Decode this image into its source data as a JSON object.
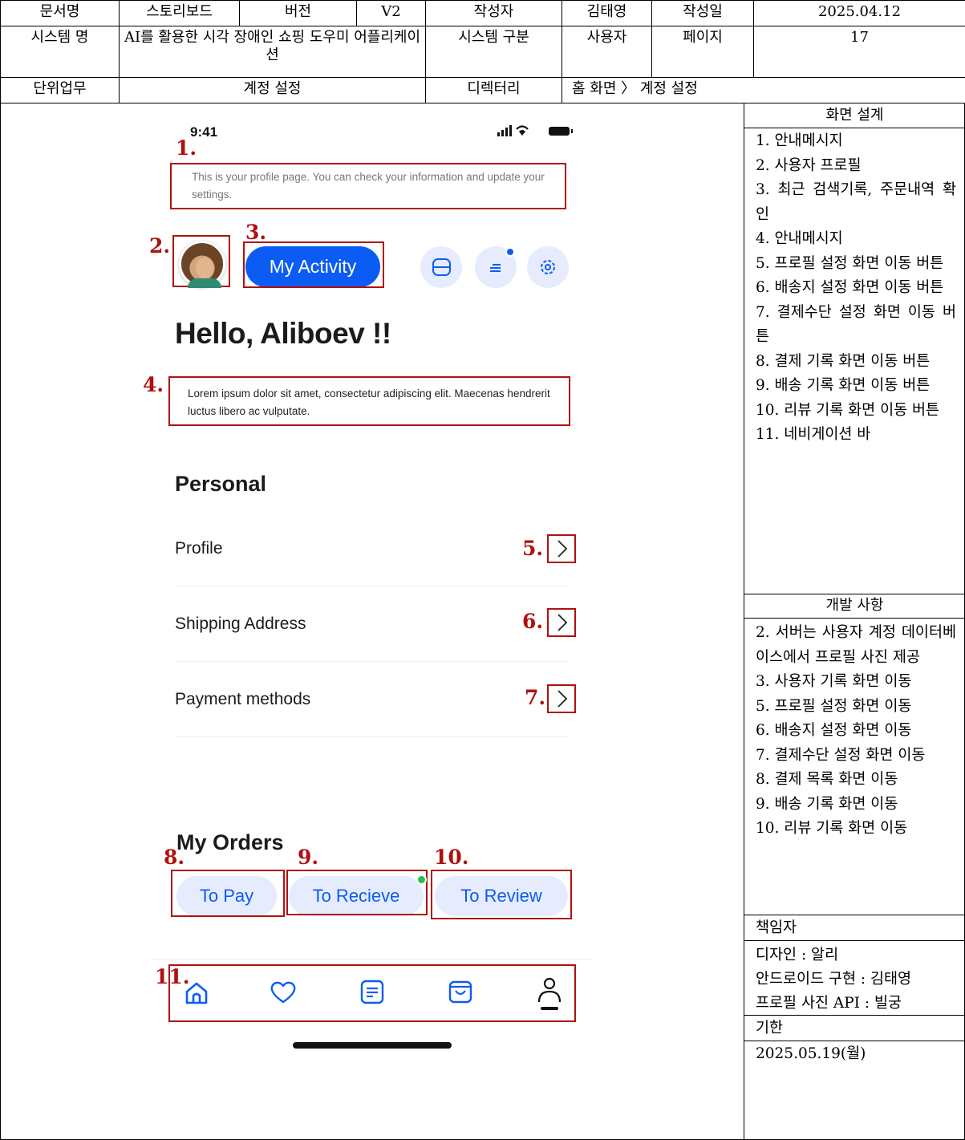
{
  "header": {
    "doc_name_label": "문서명",
    "doc_name": "스토리보드",
    "version_label": "버전",
    "version": "V2",
    "author_label": "작성자",
    "author": "김태영",
    "date_label": "작성일",
    "date": "2025.04.12",
    "system_name_label": "시스템 명",
    "system_name": "AI를 활용한 시각 장애인 쇼핑 도우미 어플리케이션",
    "system_type_label": "시스템 구분",
    "system_type": "사용자",
    "page_label": "페이지",
    "page": "17",
    "unit_task_label": "단위업무",
    "unit_task": "계정 설정",
    "directory_label": "디렉터리",
    "directory": "홈 화면 〉 계정 설정"
  },
  "right_panel": {
    "design_title": "화면 설계",
    "design_items": [
      "1. 안내메시지",
      "2. 사용자 프로필",
      "3. 최근 검색기록, 주문내역 확인",
      "4. 안내메시지",
      "5. 프로필 설정 화면 이동 버튼",
      "6. 배송지 설정 화면 이동 버튼",
      "7. 결제수단 설정 화면 이동 버튼",
      "8. 결제 기록 화면 이동 버튼",
      "9. 배송 기록 화면 이동 버튼",
      "10. 리뷰 기록 화면 이동 버튼",
      "11. 네비게이션 바"
    ],
    "dev_title": "개발 사항",
    "dev_items": [
      "2. 서버는 사용자 계정 데이터베이스에서 프로필 사진 제공",
      "3. 사용자 기록 화면 이동",
      "5. 프로필 설정 화면 이동",
      "6. 배송지 설정 화면 이동",
      "7. 결제수단 설정 화면 이동",
      "8. 결제 목록 화면 이동",
      "9. 배송 기록 화면 이동",
      "10. 리뷰 기록 화면 이동"
    ],
    "owner_title": "책임자",
    "owners": [
      "디자인 : 알리",
      "안드로이드 구현 : 김태영",
      "프로필 사진 API : 빌궁"
    ],
    "deadline_title": "기한",
    "deadline": "2025.05.19(월)"
  },
  "phone": {
    "status_time": "9:41",
    "status_icons": "signal-wifi-battery",
    "notice_1": "This is your profile page. You can check your information and update your settings.",
    "my_activity": "My Activity",
    "greeting": "Hello, Aliboev !!",
    "notice_2": "Lorem ipsum dolor sit amet, consectetur adipiscing elit. Maecenas hendrerit luctus libero ac vulputate.",
    "personal_title": "Personal",
    "rows": [
      "Profile",
      "Shipping Address",
      "Payment methods"
    ],
    "orders_title": "My Orders",
    "order_buttons": [
      "To Pay",
      "To Recieve",
      "To Review"
    ],
    "nav_icons": [
      "home-icon",
      "heart-icon",
      "list-icon",
      "bag-icon",
      "user-icon"
    ],
    "accent_color": "#0b5cf5",
    "marker_color": "#b01010"
  },
  "markers": {
    "m1": "1.",
    "m2": "2.",
    "m3": "3.",
    "m4": "4.",
    "m5": "5.",
    "m6": "6.",
    "m7": "7.",
    "m8": "8.",
    "m9": "9.",
    "m10": "10.",
    "m11": "11."
  }
}
